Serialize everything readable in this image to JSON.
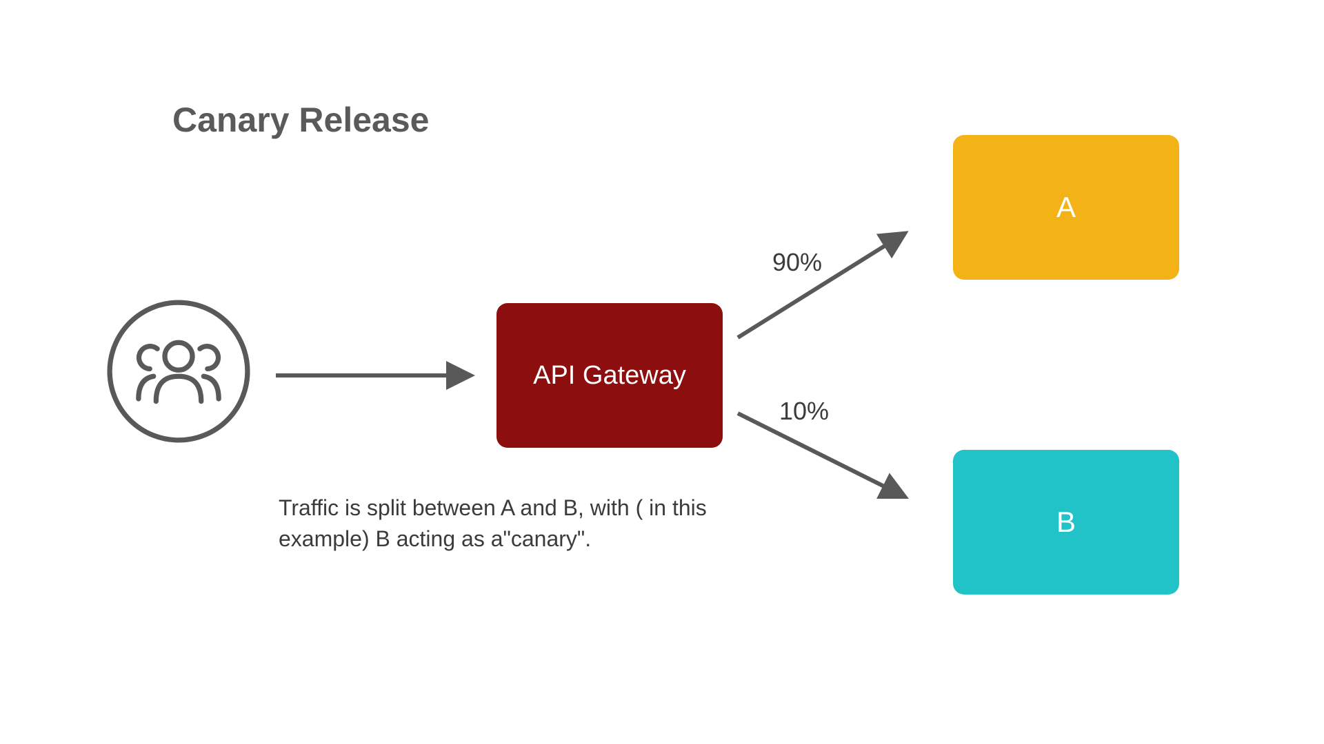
{
  "title": "Canary Release",
  "gateway_label": "API Gateway",
  "box_a_label": "A",
  "box_b_label": "B",
  "percent_a": "90%",
  "percent_b": "10%",
  "caption": "Traffic is split between A and B, with ( in this example) B acting as a\"canary\".",
  "colors": {
    "gateway": "#8c0e0e",
    "box_a": "#f3b316",
    "box_b": "#21c2c8",
    "arrow": "#595959",
    "text": "#3b3b3b"
  }
}
